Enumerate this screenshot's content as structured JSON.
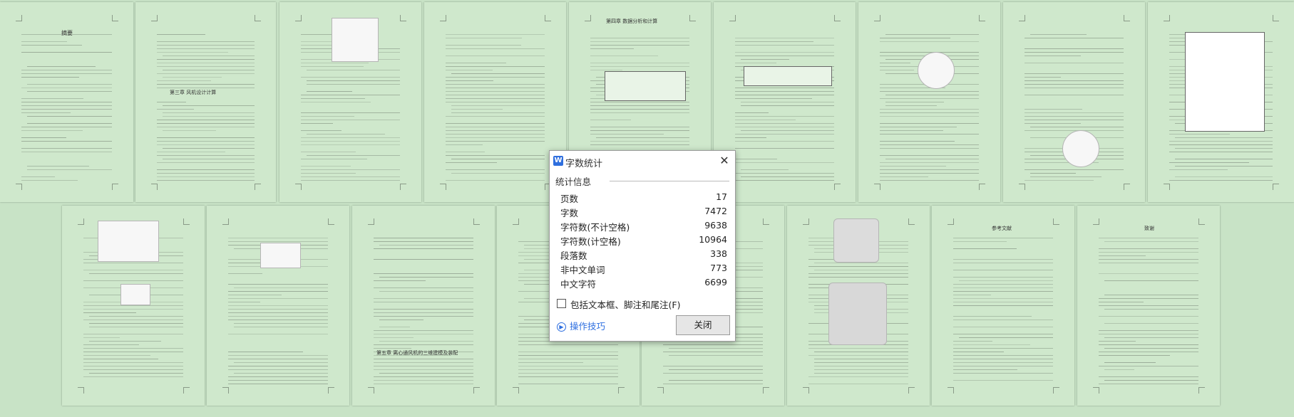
{
  "dialog": {
    "title": "字数统计",
    "section_title": "统计信息",
    "stats": [
      {
        "label": "页数",
        "value": "17"
      },
      {
        "label": "字数",
        "value": "7472"
      },
      {
        "label": "字符数(不计空格)",
        "value": "9638"
      },
      {
        "label": "字符数(计空格)",
        "value": "10964"
      },
      {
        "label": "段落数",
        "value": "338"
      },
      {
        "label": "非中文单词",
        "value": "773"
      },
      {
        "label": "中文字符",
        "value": "6699"
      }
    ],
    "checkbox_label": "包括文本框、脚注和尾注(F)",
    "checkbox_checked": false,
    "tips_label": "操作技巧",
    "close_label": "关闭",
    "close_glyph": "✕"
  },
  "pages": {
    "p1_title": "摘要",
    "p2_title": "第三章 风机设计计算",
    "p4_title": "第四章 数据分析和计算",
    "p14_title": "第五章 离心通风机的三维建模及装配",
    "p16_title": "参考文献",
    "p17_title": "致谢"
  },
  "colors": {
    "background": "#c8e3c6",
    "page": "#cfe8cc",
    "dialog": "#ffffff",
    "link": "#2e6fe0"
  }
}
